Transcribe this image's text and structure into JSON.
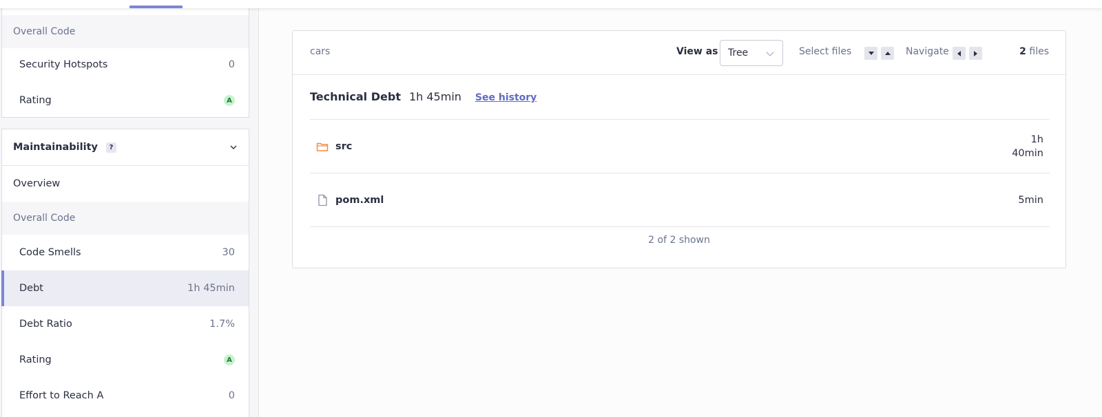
{
  "sidebar": {
    "top_section": {
      "label": "Overall Code",
      "rows": [
        {
          "label": "Security Hotspots",
          "value": "0"
        },
        {
          "label": "Rating",
          "value": "A"
        }
      ]
    },
    "maintainability": {
      "title": "Maintainability",
      "help": "?",
      "overview_label": "Overview",
      "section_label": "Overall Code",
      "rows": [
        {
          "label": "Code Smells",
          "value": "30"
        },
        {
          "label": "Debt",
          "value": "1h 45min",
          "active": true
        },
        {
          "label": "Debt Ratio",
          "value": "1.7%"
        },
        {
          "label": "Rating",
          "value": "A"
        },
        {
          "label": "Effort to Reach A",
          "value": "0"
        }
      ]
    }
  },
  "toolbar": {
    "breadcrumb": "cars",
    "view_as_label": "View as",
    "view_as_value": "Tree",
    "select_files_label": "Select files",
    "navigate_label": "Navigate",
    "files_count": "2",
    "files_suffix": "files"
  },
  "measure": {
    "name": "Technical Debt",
    "value": "1h 45min",
    "history_link": "See history"
  },
  "files": [
    {
      "name": "src",
      "type": "folder",
      "value_line1": "1h",
      "value_line2": "40min"
    },
    {
      "name": "pom.xml",
      "type": "file",
      "value_line1": "5min"
    }
  ],
  "shown_text": "2 of 2 shown",
  "colors": {
    "accent": "#7b85d7",
    "link": "#5f6bc5",
    "folder": "#f0883e",
    "rating_a_bg": "#c8f2cf",
    "rating_a_fg": "#1d7a35"
  }
}
